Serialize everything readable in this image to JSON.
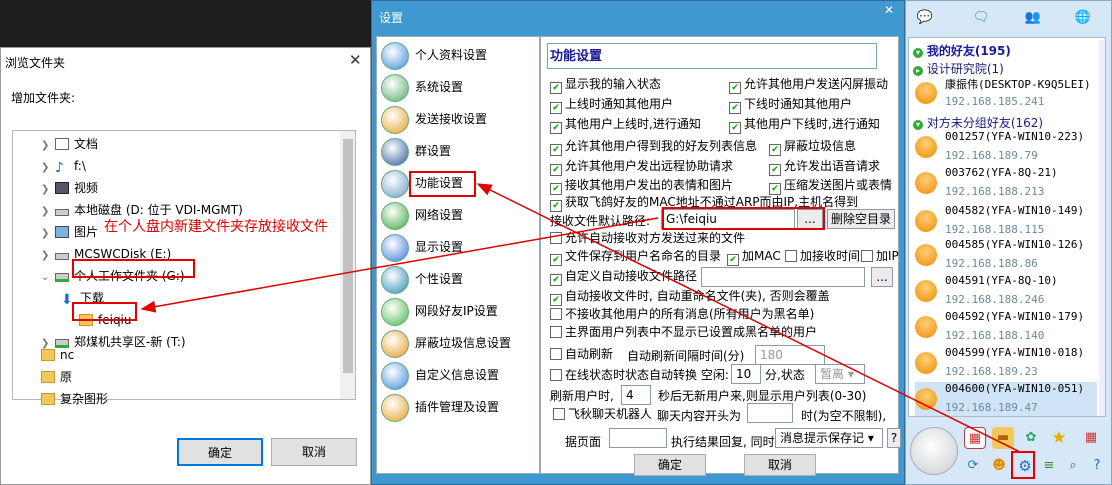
{
  "browse": {
    "title": "浏览文件夹",
    "subtitle": "增加文件夹:",
    "tree": [
      {
        "label": "文档",
        "icon": "document-icon"
      },
      {
        "label": "f:\\",
        "icon": "music-icon"
      },
      {
        "label": "视频",
        "icon": "video-icon"
      },
      {
        "label": "本地磁盘 (D: 位于 VDI-MGMT)",
        "icon": "drive-icon"
      },
      {
        "label": "图片",
        "icon": "picture-icon"
      },
      {
        "label": "MCSWCDisk (E:)",
        "icon": "drive-icon"
      },
      {
        "label": "个人工作文件夹 (G:)",
        "icon": "network-drive-icon"
      },
      {
        "label": "下载",
        "icon": "download-arrow-icon"
      },
      {
        "label": "feiqiu",
        "icon": "folder-icon"
      },
      {
        "label": "郑煤机共享区-新 (T:)",
        "icon": "network-drive-icon"
      }
    ],
    "folders": [
      "nc",
      "原",
      "复杂图形"
    ],
    "ok": "确定",
    "cancel": "取消",
    "annotation": "在个人盘内新建文件夹存放接收文件"
  },
  "settings": {
    "title": "设置",
    "menu": [
      "个人资料设置",
      "系统设置",
      "发送接收设置",
      "群设置",
      "功能设置",
      "网络设置",
      "显示设置",
      "个性设置",
      "网段好友IP设置",
      "屏蔽垃圾信息设置",
      "自定义信息设置",
      "插件管理及设置"
    ],
    "panel_title": "功能设置",
    "opts": {
      "o1": "显示我的输入状态",
      "o2": "允许其他用户发送闪屏振动",
      "o3": "上线时通知其他用户",
      "o4": "下线时通知其他用户",
      "o5": "其他用户上线时,进行通知",
      "o6": "其他用户下线时,进行通知",
      "o7": "允许其他用户得到我的好友列表信息",
      "o8": "屏蔽垃圾信息",
      "o9": "允许其他用户发出远程协助请求",
      "o10": "允许发出语音请求",
      "o11": "接收其他用户发出的表情和图片",
      "o12": "压缩发送图片或表情",
      "o13": "获取飞鸽好友的MAC地址不通过ARP而由IP,主机名得到",
      "path_label": "接收文件默认路径:",
      "path_value": "G:\\feiqiu",
      "browse_btn": "...",
      "delete_btn": "删除空目录",
      "o14": "允许自动接收对方发送过来的文件",
      "o15": "文件保存到用户名命名的目录",
      "o16": "加MAC",
      "o17": "加接收时间",
      "o18": "加IP",
      "o19": "自定义自动接收文件路径",
      "browse_btn2": "...",
      "o20": "自动接收文件时, 自动重命名文件(夹), 否则会覆盖",
      "o21": "不接收其他用户的所有消息(所有用户为黑名单)",
      "o22": "主界面用户列表中不显示已设置成黑名单的用户",
      "o23": "自动刷新",
      "refresh_label": "自动刷新间隔时间(分)",
      "refresh_value": "180",
      "o24": "在线状态时状态自动转换 空闲:",
      "idle_value": "10",
      "idle_unit": "分,状态",
      "idle_status": "暂离",
      "refresh_users_a": "刷新用户时,",
      "refresh_users_value": "4",
      "refresh_users_b": "秒后无新用户来,则显示用户列表(0-30)",
      "o25": "飞秋聊天机器人",
      "chat_prefix": "聊天内容开头为",
      "chat_time": "时(为空不限制),",
      "page_label": "据页面",
      "exec_label": "执行结果回复, 同时",
      "exec_select": "消息提示保存记",
      "help": "?"
    },
    "checked": {
      "o1": true,
      "o2": true,
      "o3": true,
      "o4": true,
      "o5": true,
      "o6": true,
      "o7": true,
      "o8": true,
      "o9": true,
      "o10": true,
      "o11": true,
      "o12": true,
      "o13": true,
      "o14": false,
      "o15": true,
      "o16": true,
      "o17": false,
      "o18": false,
      "o19": true,
      "o20": true,
      "o21": false,
      "o22": false,
      "o23": false,
      "o24": false,
      "o25": false
    },
    "ok": "确定",
    "cancel": "取消"
  },
  "qq": {
    "my_friends": "我的好友(195)",
    "group1": "设计研究院(1)",
    "group2": "对方未分组好友(162)",
    "friends": [
      {
        "name": "康振伟(DESKTOP-K9Q5LEI)",
        "ip": "192.168.185.241"
      },
      {
        "name": "001257(YFA-WIN10-223)",
        "ip": "192.168.189.79"
      },
      {
        "name": "003762(YFA-8Q-21)",
        "ip": "192.168.188.213"
      },
      {
        "name": "004582(YFA-WIN10-149)",
        "ip": "192.168.188.115"
      },
      {
        "name": "004585(YFA-WIN10-126)",
        "ip": "192.168.188.86"
      },
      {
        "name": "004591(YFA-8Q-10)",
        "ip": "192.168.188.246"
      },
      {
        "name": "004592(YFA-WIN10-179)",
        "ip": "192.168.188.140"
      },
      {
        "name": "004599(YFA-WIN10-018)",
        "ip": "192.168.189.23"
      },
      {
        "name": "004600(YFA-WIN10-051)",
        "ip": "192.168.189.47"
      }
    ]
  }
}
